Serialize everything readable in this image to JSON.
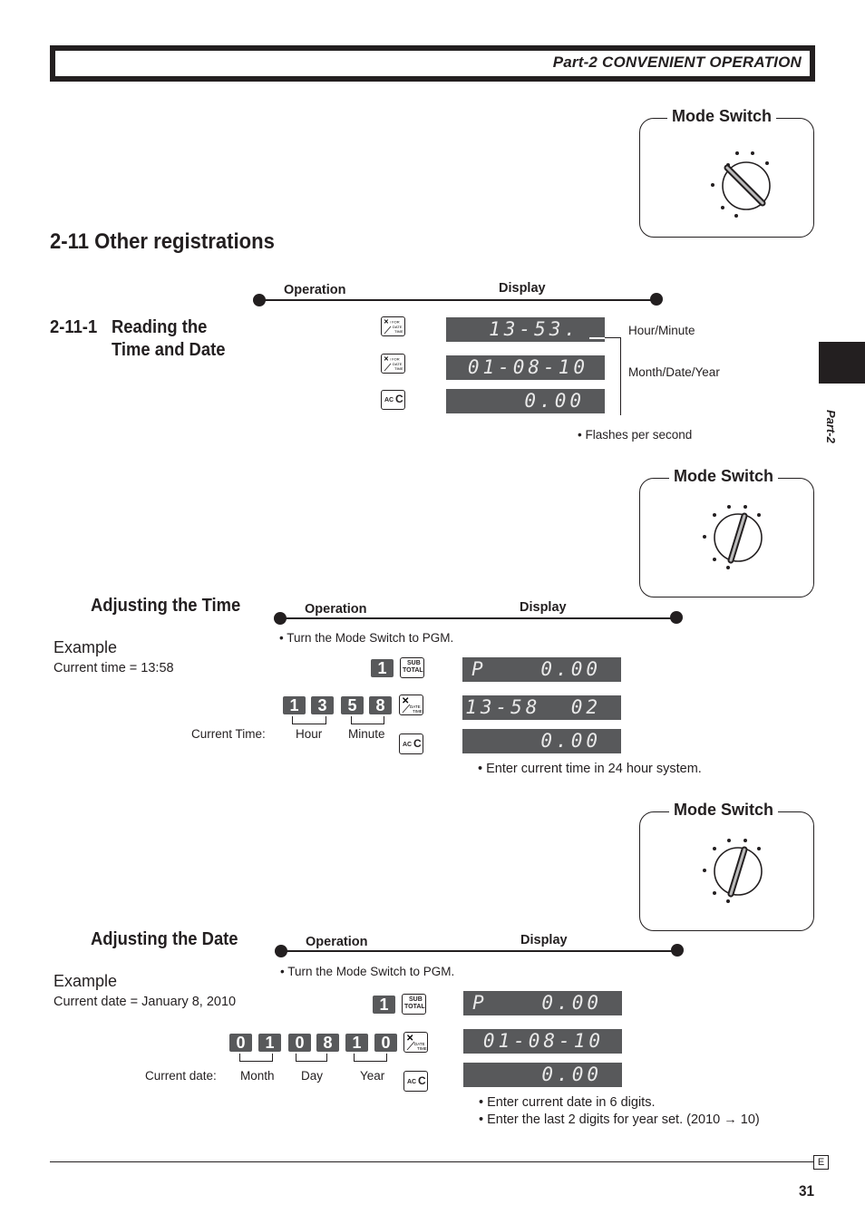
{
  "header": {
    "title": "Part-2 CONVENIENT OPERATION"
  },
  "side_tab": {
    "label": "Part-2"
  },
  "section": {
    "number_title": "2-11  Other registrations"
  },
  "subsection": {
    "number": "2-11-1",
    "title_line1": "Reading the",
    "title_line2": "Time and Date"
  },
  "mode_switch_label": "Mode Switch",
  "operation_label": "Operation",
  "display_label": "Display",
  "keys": {
    "x_for_date_time": {
      "top": "X / FOR",
      "mid": "DATE",
      "bot": "TIME"
    },
    "ac_c": {
      "small": "AC",
      "big": "C"
    },
    "subtotal": {
      "line1": "SUB",
      "line2": "TOTAL"
    }
  },
  "reading": {
    "displays": [
      {
        "left": "",
        "right": "13-53."
      },
      {
        "left": "",
        "right": "01-08-10"
      },
      {
        "left": "",
        "right": "0.00"
      }
    ],
    "annotations": {
      "hour_minute": "Hour/Minute",
      "month_date_year": "Month/Date/Year",
      "flashes": "•  Flashes per second"
    }
  },
  "adjust_time": {
    "title": "Adjusting the Time",
    "example_label": "Example",
    "example_value": "Current time = 13:58",
    "instruction": "• Turn the Mode Switch to PGM.",
    "step1_digit": "1",
    "step2_digits": [
      "1",
      "3",
      "5",
      "8"
    ],
    "caption_label": "Current  Time:",
    "groups": [
      "Hour",
      "Minute"
    ],
    "displays": [
      {
        "left": "P",
        "right": "0.00"
      },
      {
        "left": "",
        "right": "13-58  02"
      },
      {
        "left": "",
        "right": "0.00"
      }
    ],
    "note": "• Enter current time in 24 hour system."
  },
  "adjust_date": {
    "title": "Adjusting the Date",
    "example_label": "Example",
    "example_value": "Current date = January 8, 2010",
    "instruction": "• Turn the Mode Switch to PGM.",
    "step1_digit": "1",
    "step2_digits": [
      "0",
      "1",
      "0",
      "8",
      "1",
      "0"
    ],
    "caption_label": "Current  date:",
    "groups": [
      "Month",
      "Day",
      "Year"
    ],
    "displays": [
      {
        "left": "P",
        "right": "0.00"
      },
      {
        "left": "",
        "right": "01-08-10"
      },
      {
        "left": "",
        "right": "0.00"
      }
    ],
    "notes": [
      "• Enter current date in 6 digits.",
      "• Enter the last 2 digits for year set. (2010 → 10)"
    ]
  },
  "footer": {
    "lang_box": "E",
    "page_number": "31"
  }
}
